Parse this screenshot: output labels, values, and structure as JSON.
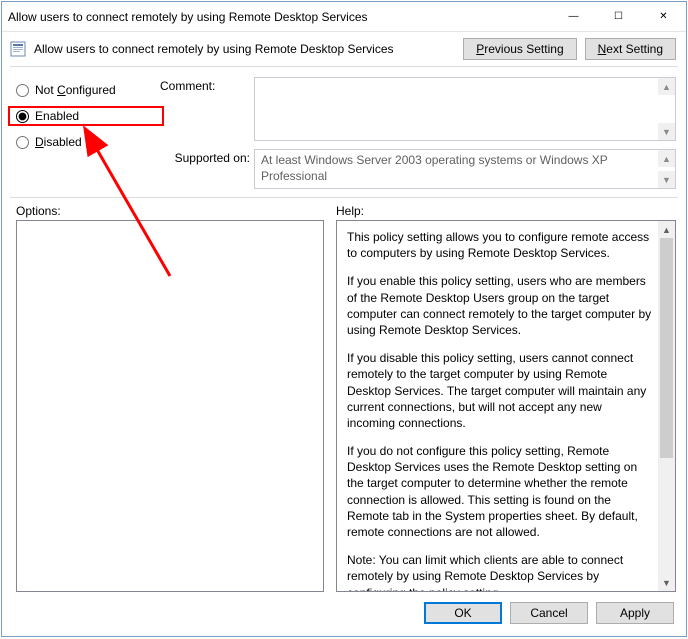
{
  "titlebar": {
    "title": "Allow users to connect remotely by using Remote Desktop Services"
  },
  "header": {
    "policy_title": "Allow users to connect remotely by using Remote Desktop Services",
    "previous_label_pre": "P",
    "previous_label_post": "revious Setting",
    "next_label_pre": "N",
    "next_label_post": "ext Setting"
  },
  "radios": {
    "not_configured_pre": "Not ",
    "not_configured_key": "C",
    "not_configured_post": "onfigured",
    "enabled_key": "E",
    "enabled_post": "nabled",
    "disabled_key": "D",
    "disabled_post": "isabled",
    "selected": "enabled"
  },
  "labels": {
    "comment": "Comment:",
    "supported": "Supported on:",
    "options": "Options:",
    "help": "Help:"
  },
  "supported_text": "At least Windows Server 2003 operating systems or Windows XP Professional",
  "help": {
    "p1": "This policy setting allows you to configure remote access to computers by using Remote Desktop Services.",
    "p2": "If you enable this policy setting, users who are members of the Remote Desktop Users group on the target computer can connect remotely to the target computer by using Remote Desktop Services.",
    "p3": "If you disable this policy setting, users cannot connect remotely to the target computer by using Remote Desktop Services. The target computer will maintain any current connections, but will not accept any new incoming connections.",
    "p4": "If you do not configure this policy setting, Remote Desktop Services uses the Remote Desktop setting on the target computer to determine whether the remote connection is allowed. This setting is found on the Remote tab in the System properties sheet. By default, remote connections are not allowed.",
    "p5": "Note: You can limit which clients are able to connect remotely by using Remote Desktop Services by configuring the policy setting"
  },
  "buttons": {
    "ok": "OK",
    "cancel": "Cancel",
    "apply": "Apply"
  },
  "glyphs": {
    "min": "—",
    "max": "☐",
    "close": "✕",
    "up": "▲",
    "down": "▼"
  }
}
